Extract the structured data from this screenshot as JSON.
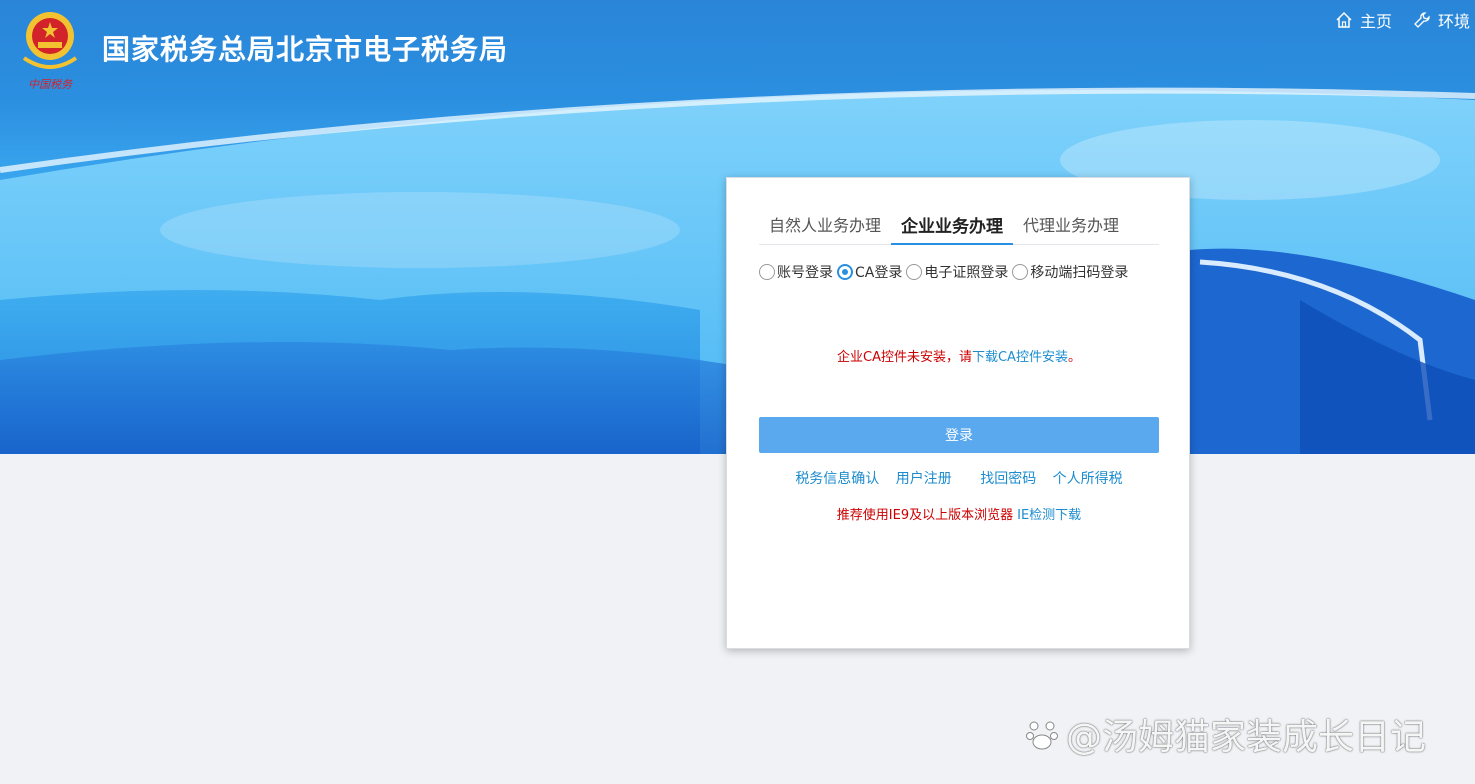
{
  "header": {
    "site_title": "国家税务总局北京市电子税务局",
    "emblem_caption": "中国税务",
    "nav": [
      {
        "label": "主页",
        "icon": "home-icon"
      },
      {
        "label": "环境",
        "icon": "wrench-icon"
      }
    ]
  },
  "login_panel": {
    "tabs": [
      {
        "label": "自然人业务办理",
        "active": false
      },
      {
        "label": "企业业务办理",
        "active": true
      },
      {
        "label": "代理业务办理",
        "active": false
      }
    ],
    "modes": [
      {
        "label": "账号登录",
        "checked": false
      },
      {
        "label": "CA登录",
        "checked": true
      },
      {
        "label": "电子证照登录",
        "checked": false
      },
      {
        "label": "移动端扫码登录",
        "checked": false
      }
    ],
    "notice": {
      "text": "企业CA控件未安装，请",
      "link": "下载CA控件安装",
      "suffix": "。"
    },
    "login_button": "登录",
    "links": [
      "税务信息确认",
      "用户注册",
      "找回密码",
      "个人所得税"
    ],
    "browser_note": {
      "warning": "推荐使用IE9及以上版本浏览器",
      "link": "IE检测下载"
    }
  },
  "watermark": "@汤姆猫家装成长日记",
  "colors": {
    "accent": "#2b8fe0",
    "link": "#1c8ccf",
    "warning": "#cc0000",
    "button": "#5aa9ee"
  }
}
